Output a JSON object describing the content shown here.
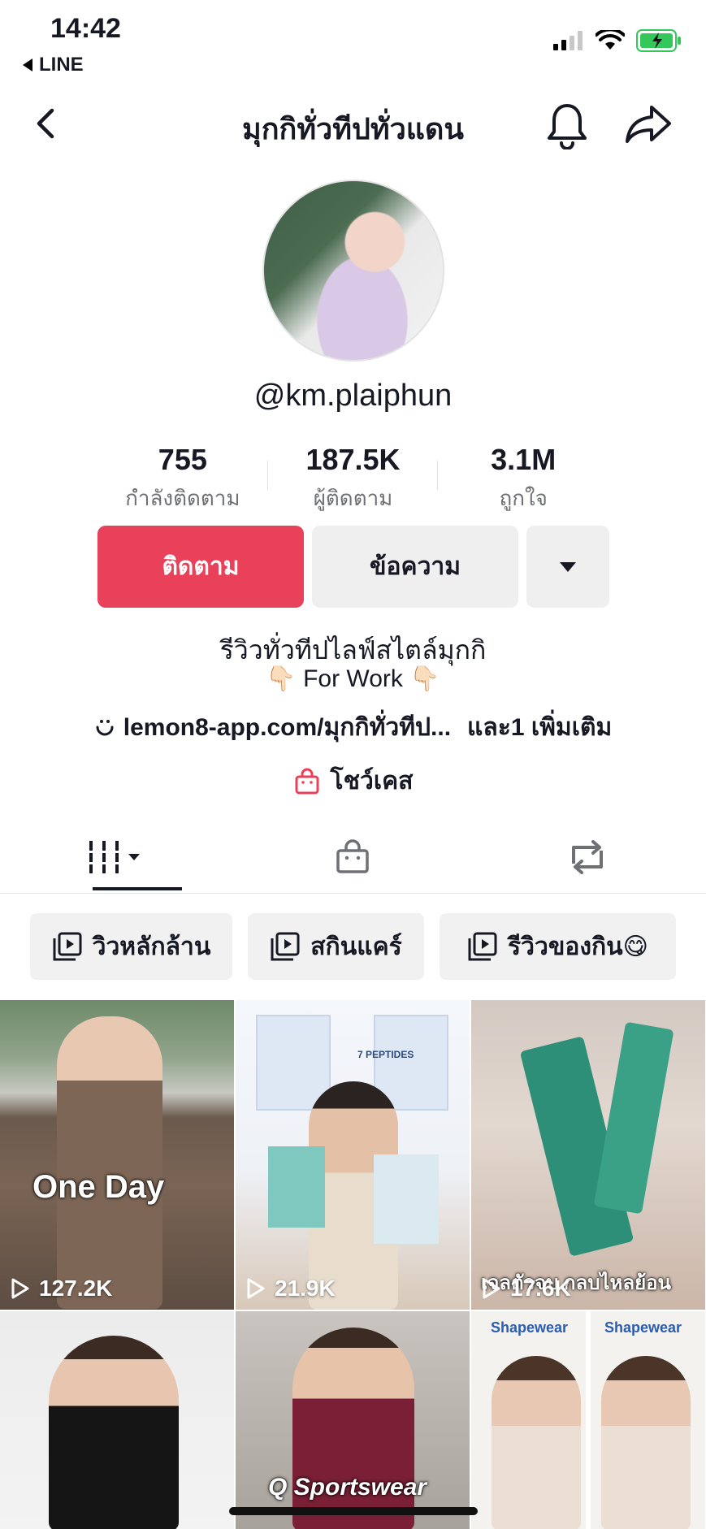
{
  "status_bar": {
    "time": "14:42",
    "back_app": "LINE"
  },
  "nav": {
    "title": "มุกกิทั่วทีปทั่วแดน"
  },
  "profile": {
    "username": "@km.plaiphun",
    "stats": [
      {
        "value": "755",
        "label": "กำลังติดตาม"
      },
      {
        "value": "187.5K",
        "label": "ผู้ติดตาม"
      },
      {
        "value": "3.1M",
        "label": "ถูกใจ"
      }
    ],
    "follow_label": "ติดตาม",
    "message_label": "ข้อความ",
    "bio_line1": "รีวิวทั่วทีปไลฟ์สไตล์มุกกิ",
    "bio_line2": "For Work",
    "link_text": "lemon8-app.com/มุกกิทั่วทีป...",
    "link_more": "และ1 เพิ่มเติม",
    "showcase_label": "โชว์เคส"
  },
  "playlists": [
    {
      "label": "วิวหลักล้าน"
    },
    {
      "label": "สกินแคร์"
    },
    {
      "label": "รีวิวของกิน😋"
    }
  ],
  "videos": [
    {
      "views": "127.2K",
      "caption": "One Day"
    },
    {
      "views": "21.9K",
      "caption": "7 PEPTIDES"
    },
    {
      "views": "17.6K",
      "caption": "เจลตัวจบ กลบไหลย้อน"
    },
    {
      "views": "",
      "caption": ""
    },
    {
      "views": "",
      "caption": "Q Sportswear"
    },
    {
      "views": "",
      "caption": "Shapewear"
    }
  ],
  "colors": {
    "accent": "#ea415b",
    "chip_bg": "#f1f1f2",
    "text": "#161823"
  }
}
